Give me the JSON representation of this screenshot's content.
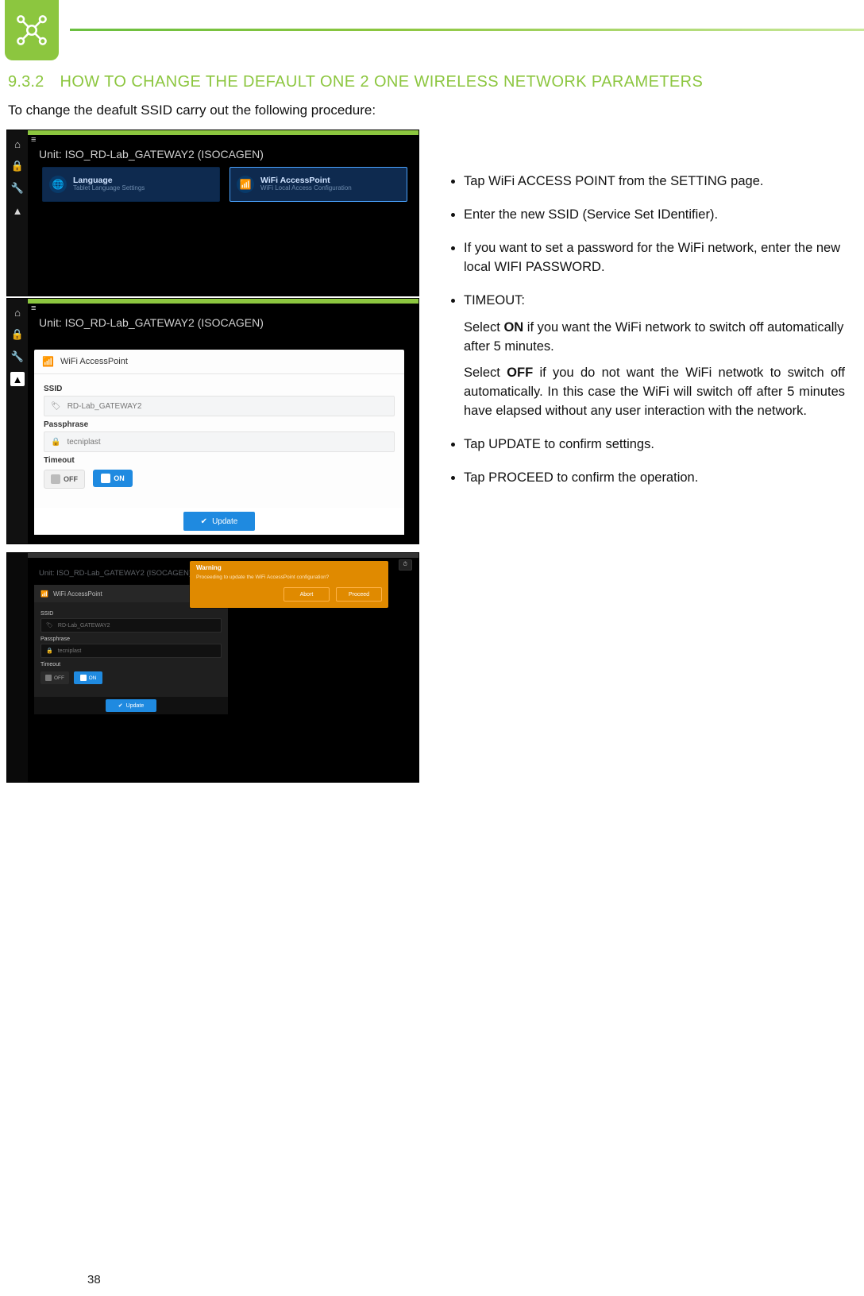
{
  "section": {
    "number": "9.3.2",
    "title": "HOW TO CHANGE THE DEFAULT ONE 2 ONE WIRELESS NETWORK PARAMETERS"
  },
  "intro": "To change the deafult SSID carry out the following procedure:",
  "page_number": "38",
  "screenshot1": {
    "unit": "Unit: ISO_RD-Lab_GATEWAY2 (ISOCAGEN)",
    "cards": {
      "language": {
        "title": "Language",
        "sub": "Tablet Language Settings"
      },
      "wifi": {
        "title": "WiFi AccessPoint",
        "sub": "WiFi Local Access Configuration"
      }
    }
  },
  "screenshot2": {
    "unit": "Unit: ISO_RD-Lab_GATEWAY2 (ISOCAGEN)",
    "panel_title": "WiFi AccessPoint",
    "ssid_label": "SSID",
    "ssid_value": "RD-Lab_GATEWAY2",
    "pass_label": "Passphrase",
    "pass_value": "tecniplast",
    "timeout_label": "Timeout",
    "off": "OFF",
    "on": "ON",
    "update": "Update"
  },
  "screenshot3": {
    "unit": "Unit: ISO_RD-Lab_GATEWAY2 (ISOCAGEN)",
    "panel_title": "WiFi AccessPoint",
    "ssid_label": "SSID",
    "ssid_value": "RD-Lab_GATEWAY2",
    "pass_label": "Passphrase",
    "pass_value": "tecniplast",
    "timeout_label": "Timeout",
    "off": "OFF",
    "on": "ON",
    "update": "Update",
    "dialog": {
      "title": "Warning",
      "msg": "Proceeding to update the WiFi AccessPoint configuration?",
      "abort": "Abort",
      "proceed": "Proceed"
    }
  },
  "instructions": {
    "i1": "Tap WiFi ACCESS POINT  from the SETTING page.",
    "i2": "Enter the new SSID (Service Set IDentifier).",
    "i3": "If you want to set a password for the WiFi network, enter the new local WIFI PASSWORD.",
    "i4": "TIMEOUT:",
    "i4a_pre": "Select ",
    "i4a_b": "ON",
    "i4a_post": " if you want the WiFi network to switch off automatically after 5 minutes.",
    "i4b_pre": "Select ",
    "i4b_b": "OFF",
    "i4b_post": " if you do not want the WiFi netwotk  to switch off automatically. In this case the WiFi will switch off after 5 minutes have elapsed without any user interaction with the network.",
    "i5": "Tap UPDATE to confirm settings.",
    "i6": "Tap PROCEED to confirm the operation."
  }
}
